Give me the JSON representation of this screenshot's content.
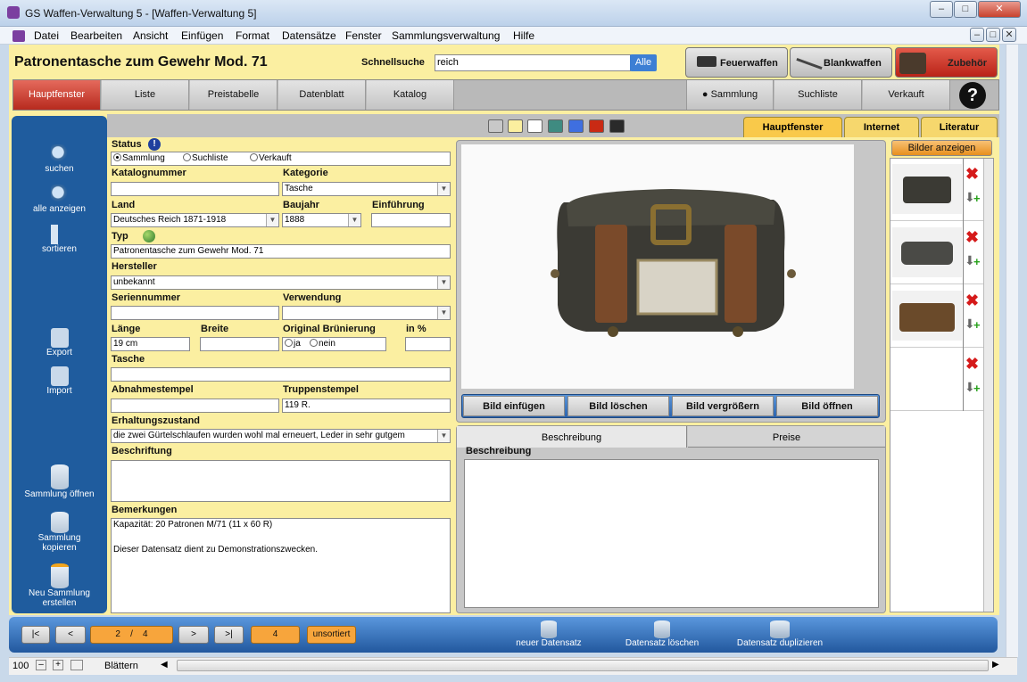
{
  "window": {
    "title": "GS Waffen-Verwaltung 5 - [Waffen-Verwaltung 5]"
  },
  "menu": [
    "Datei",
    "Bearbeiten",
    "Ansicht",
    "Einfügen",
    "Format",
    "Datensätze",
    "Fenster",
    "Sammlungsverwaltung",
    "Hilfe"
  ],
  "header": {
    "title": "Patronentasche zum Gewehr Mod. 71",
    "quicksearch_label": "Schnellsuche",
    "quicksearch_value": "reich",
    "quicksearch_btn": "Alle"
  },
  "top_buttons": {
    "firearms": "Feuerwaffen",
    "blades": "Blankwaffen",
    "accessories": "Zubehör"
  },
  "nav_tabs": [
    "Hauptfenster",
    "Liste",
    "Preistabelle",
    "Datenblatt",
    "Katalog"
  ],
  "nav_right": {
    "collection": "Sammlung",
    "wishlist": "Suchliste",
    "sold": "Verkauft",
    "help": "?"
  },
  "sidebar": {
    "search": "suchen",
    "show_all": "alle anzeigen",
    "sort": "sortieren",
    "export": "Export",
    "import": "Import",
    "open_collection": "Sammlung öffnen",
    "copy_collection": "Sammlung kopieren",
    "new_collection": "Neu Sammlung erstellen"
  },
  "right_tabs": [
    "Hauptfenster",
    "Internet",
    "Literatur"
  ],
  "form": {
    "status_label": "Status",
    "status_options": [
      "Sammlung",
      "Suchliste",
      "Verkauft"
    ],
    "katalognummer_label": "Katalognummer",
    "katalognummer": "",
    "kategorie_label": "Kategorie",
    "kategorie": "Tasche",
    "land_label": "Land",
    "land": "Deutsches Reich 1871-1918",
    "baujahr_label": "Baujahr",
    "baujahr": "1888",
    "einfuehrung_label": "Einführung",
    "einfuehrung": "",
    "typ_label": "Typ",
    "typ": "Patronentasche zum Gewehr Mod. 71",
    "hersteller_label": "Hersteller",
    "hersteller": "unbekannt",
    "seriennummer_label": "Seriennummer",
    "seriennummer": "",
    "verwendung_label": "Verwendung",
    "verwendung": "",
    "laenge_label": "Länge",
    "laenge": "19 cm",
    "breite_label": "Breite",
    "breite": "",
    "bruenierung_label": "Original Brünierung",
    "bruenierung_ja": "ja",
    "bruenierung_nein": "nein",
    "inprozent_label": "in %",
    "inprozent": "",
    "tasche_label": "Tasche",
    "tasche": "",
    "abnahmestempel_label": "Abnahmestempel",
    "abnahmestempel": "",
    "truppenstempel_label": "Truppenstempel",
    "truppenstempel": "119 R.",
    "erhaltungszustand_label": "Erhaltungszustand",
    "erhaltungszustand": "die zwei Gürtelschlaufen wurden wohl mal erneuert, Leder in sehr gutgem",
    "beschriftung_label": "Beschriftung",
    "beschriftung": "",
    "bemerkungen_label": "Bemerkungen",
    "bemerkungen_1": "Kapazität: 20 Patronen M/71 (11 x 60 R)",
    "bemerkungen_2": "Dieser Datensatz dient  zu Demonstrationszwecken."
  },
  "image_buttons": [
    "Bild einfügen",
    "Bild löschen",
    "Bild vergrößern",
    "Bild öffnen"
  ],
  "desc_tabs": {
    "desc": "Beschreibung",
    "price": "Preise",
    "desc_label": "Beschreibung"
  },
  "thumbs": {
    "show_images": "Bilder anzeigen"
  },
  "bottom": {
    "first": "|<",
    "prev": "<",
    "next": ">",
    "last": ">|",
    "record_current": "2",
    "record_sep": "/",
    "record_total": "4",
    "found": "4",
    "sort": "unsortiert",
    "new_record": "neuer Datensatz",
    "delete_record": "Datensatz löschen",
    "duplicate_record": "Datensatz duplizieren"
  },
  "statusbar": {
    "zoom": "100",
    "mode": "Blättern"
  }
}
